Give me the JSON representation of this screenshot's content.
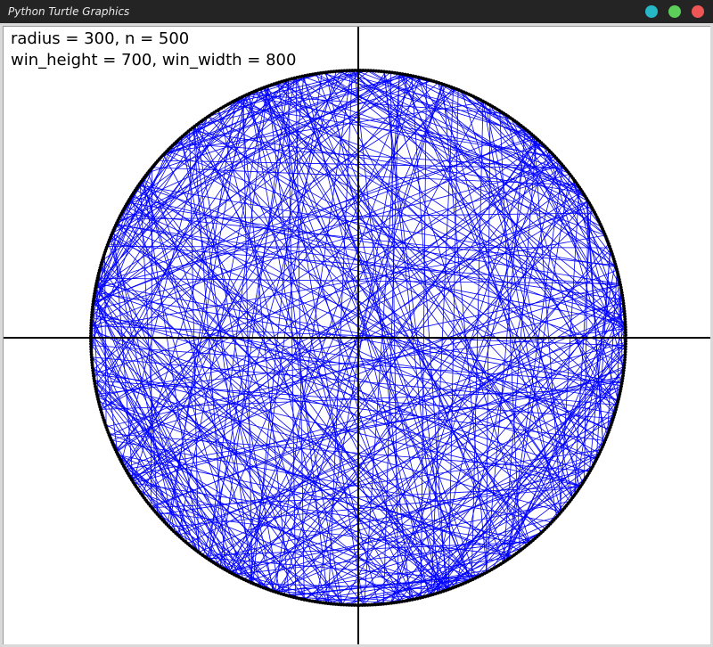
{
  "window": {
    "title": "Python Turtle Graphics",
    "buttons": {
      "minimize_color": "#27b8c8",
      "maximize_color": "#5ccf5a",
      "close_color": "#ee5656"
    }
  },
  "canvas": {
    "info_line_1": "radius = 300, n = 500",
    "info_line_2": "win_height = 700, win_width = 800",
    "radius": 300,
    "n": 500,
    "win_height": 700,
    "win_width": 800,
    "axis_color": "#000000",
    "chord_color": "#0000ff",
    "circle_color": "#000000",
    "background": "#ffffff"
  }
}
